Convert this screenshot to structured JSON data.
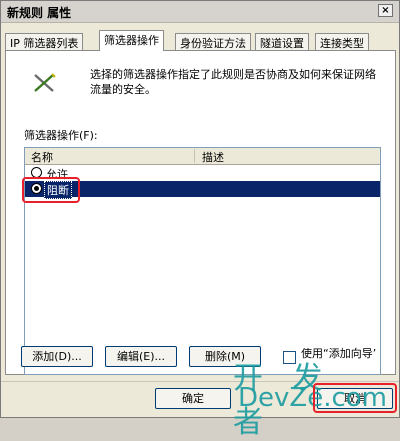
{
  "window": {
    "title": "新规则 属性",
    "close_glyph": "×"
  },
  "tabs": [
    {
      "label": "IP 筛选器列表"
    },
    {
      "label": "筛选器操作"
    },
    {
      "label": "身份验证方法"
    },
    {
      "label": "隧道设置"
    },
    {
      "label": "连接类型"
    }
  ],
  "panel": {
    "description": "选择的筛选器操作指定了此规则是否协商及如何来保证网络流量的安全。",
    "list_label": "筛选器操作(F):",
    "columns": [
      "名称",
      "描述"
    ],
    "rows": [
      {
        "name": "允许",
        "selected": false
      },
      {
        "name": "阻断",
        "selected": true
      }
    ]
  },
  "buttons": {
    "add": "添加(D)...",
    "edit": "编辑(E)...",
    "remove": "删除(M)",
    "ok": "确定",
    "cancel": "取消"
  },
  "checkbox": {
    "label": "使用“添加向导”(W)",
    "checked": false
  },
  "watermark": {
    "top": "开 发 者",
    "bottom": "DevZe.com"
  },
  "colors": {
    "selection": "#0a246a",
    "highlight_box": "#e8202a",
    "watermark": "#1a9ba0"
  }
}
